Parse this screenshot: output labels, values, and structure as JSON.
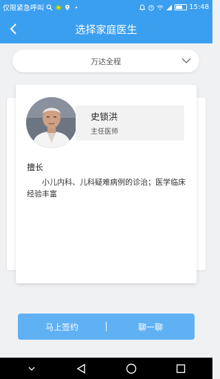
{
  "status_bar": {
    "carrier_text": "仅限紧急呼叫",
    "time": "15:48"
  },
  "header": {
    "title": "选择家庭医生"
  },
  "package_select": {
    "selected": "万达全程"
  },
  "doctor": {
    "name": "史锁洪",
    "title": "主任医师",
    "expertise_label": "擅长",
    "expertise": "小儿内科、儿科疑难病例的诊治；医学临床经验丰富"
  },
  "actions": {
    "sign_label": "马上签约",
    "chat_label": "聊一聊"
  },
  "colors": {
    "primary": "#3b9ff0",
    "action_bar": "#5fb1f4"
  }
}
